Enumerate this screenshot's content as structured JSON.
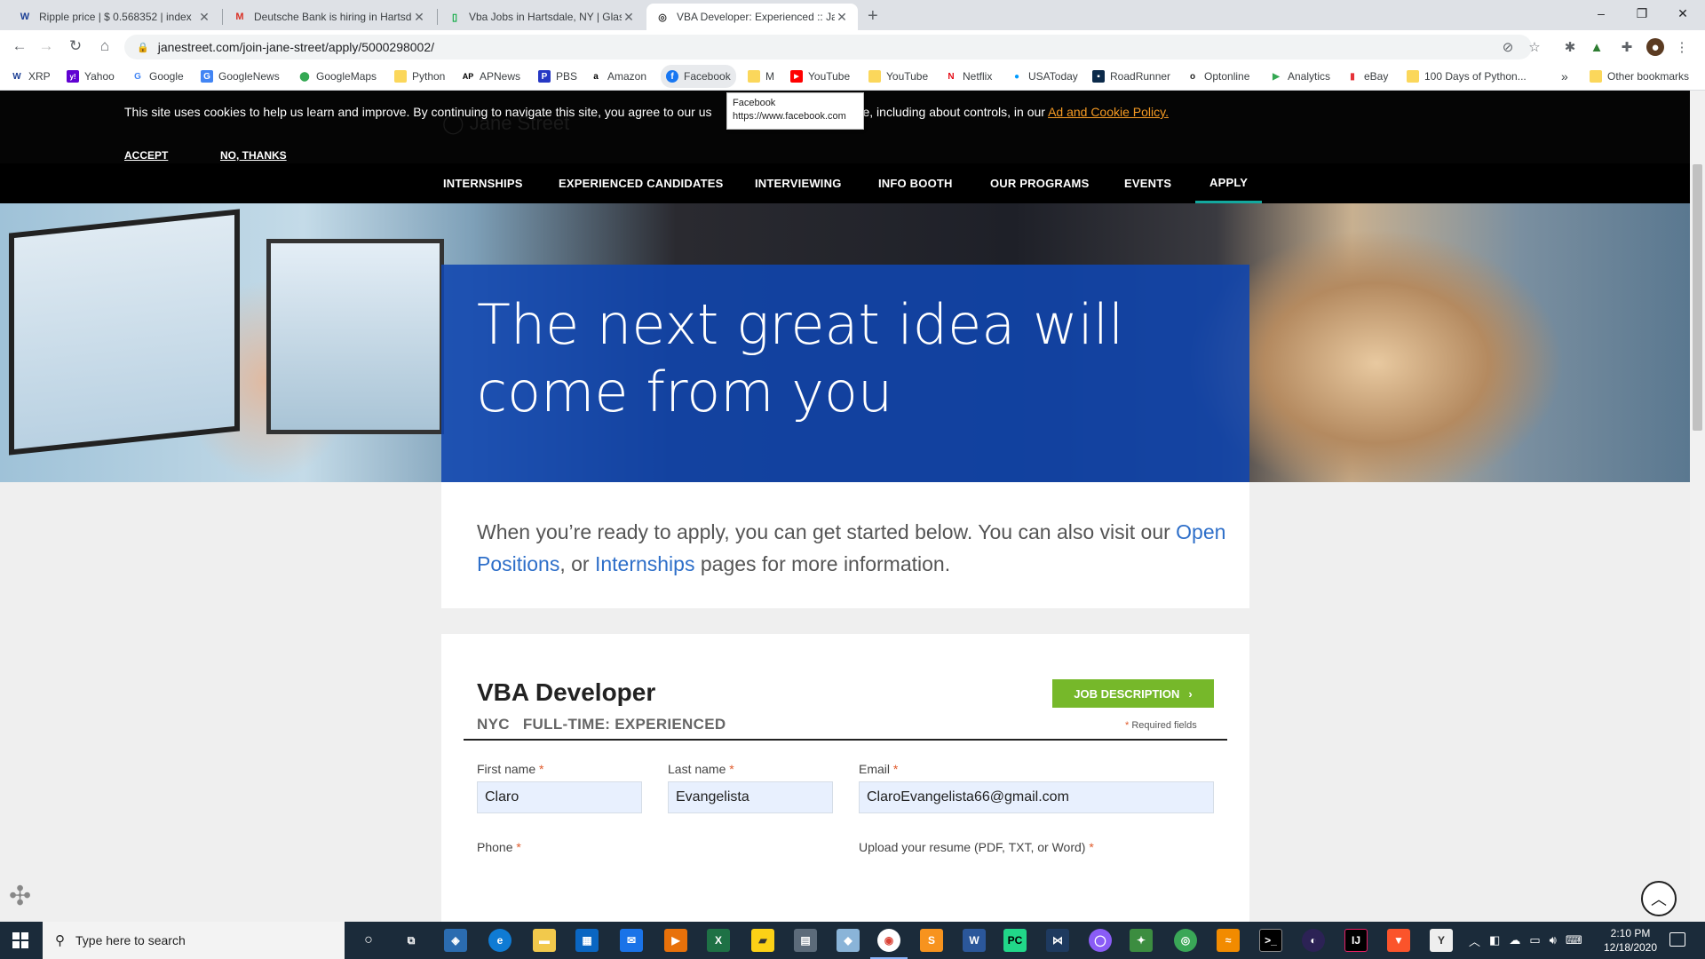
{
  "browser": {
    "tabs": [
      {
        "title": "Ripple price | $ 0.568352 | index",
        "favicon": "W",
        "favicon_color": "#1c3f95"
      },
      {
        "title": "Deutsche Bank is hiring in Hartsd",
        "favicon": "M",
        "favicon_color": "#d93025"
      },
      {
        "title": "Vba Jobs in Hartsdale, NY | Glass",
        "favicon": "▯",
        "favicon_color": "#0caa41"
      },
      {
        "title": "VBA Developer: Experienced :: Ja",
        "favicon": "◎",
        "favicon_color": "#333333"
      }
    ],
    "new_tab": "+",
    "window_controls": {
      "minimize": "–",
      "maximize": "❐",
      "close": "✕"
    },
    "url": "janestreet.com/join-jane-street/apply/5000298002/",
    "bookmarks": [
      {
        "label": "XRP",
        "icon": "W",
        "color": "#1c3f95"
      },
      {
        "label": "Yahoo",
        "icon": "y!",
        "color": "#6001d2"
      },
      {
        "label": "Google",
        "icon": "G",
        "color": "#4285f4"
      },
      {
        "label": "GoogleNews",
        "icon": "G",
        "color": "#4285f4"
      },
      {
        "label": "GoogleMaps",
        "icon": "⬤",
        "color": "#34a853"
      },
      {
        "label": "Python",
        "icon": "",
        "color": "#fbd75b"
      },
      {
        "label": "APNews",
        "icon": "AP",
        "color": "#000000"
      },
      {
        "label": "PBS",
        "icon": "P",
        "color": "#2638c4"
      },
      {
        "label": "Amazon",
        "icon": "a",
        "color": "#000000"
      },
      {
        "label": "Facebook",
        "icon": "f",
        "color": "#1877f2"
      },
      {
        "label": "M",
        "icon": "",
        "color": "#fbd75b"
      },
      {
        "label": "YouTube",
        "icon": "▶",
        "color": "#ff0000"
      },
      {
        "label": "YouTube",
        "icon": "",
        "color": "#fbd75b"
      },
      {
        "label": "Netflix",
        "icon": "N",
        "color": "#e50914"
      },
      {
        "label": "USAToday",
        "icon": "●",
        "color": "#009bff"
      },
      {
        "label": "RoadRunner",
        "icon": "▪",
        "color": "#0b2a4a"
      },
      {
        "label": "Optonline",
        "icon": "o",
        "color": "#222222"
      },
      {
        "label": "Analytics",
        "icon": "▶",
        "color": "#34a853"
      },
      {
        "label": "eBay",
        "icon": "▮",
        "color": "#e53238"
      },
      {
        "label": "100 Days of Python...",
        "icon": "",
        "color": "#fbd75b"
      }
    ],
    "bookmarks_more": "»",
    "other_bookmarks": "Other bookmarks"
  },
  "page": {
    "cookie": {
      "text_before": "This site uses cookies to help us learn and improve. By continuing to navigate this site, you agree to our us",
      "text_after": "e, including about controls, in our ",
      "link": "Ad and Cookie Policy.",
      "accept": "ACCEPT",
      "decline": "NO, THANKS"
    },
    "tooltip": {
      "title": "Facebook",
      "url": "https://www.facebook.com"
    },
    "ghost_logo": "Jane Street",
    "nav": [
      "INTERNSHIPS",
      "EXPERIENCED CANDIDATES",
      "INTERVIEWING",
      "INFO BOOTH",
      "OUR PROGRAMS",
      "EVENTS",
      "APPLY"
    ],
    "nav_active": "APPLY",
    "hero_title": "The next great idea will come from you",
    "intro": {
      "before": "When you’re ready to apply, you can get started below. You can also visit our ",
      "link1": "Open Positions",
      "middle": ", or ",
      "link2": "Internships",
      "after": " pages for more information."
    },
    "job": {
      "title": "VBA Developer",
      "location": "NYC",
      "type": "FULL-TIME: EXPERIENCED",
      "description_button": "JOB DESCRIPTION",
      "required_mark": "*",
      "required_note": "Required fields"
    },
    "form": {
      "first_name_label": "First name",
      "first_name_value": "Claro",
      "last_name_label": "Last name",
      "last_name_value": "Evangelista",
      "email_label": "Email",
      "email_value": "ClaroEvangelista66@gmail.com",
      "phone_label": "Phone",
      "resume_label": "Upload your resume (PDF, TXT, or Word)"
    }
  },
  "taskbar": {
    "search_placeholder": "Type here to search",
    "time": "2:10 PM",
    "date": "12/18/2020"
  }
}
